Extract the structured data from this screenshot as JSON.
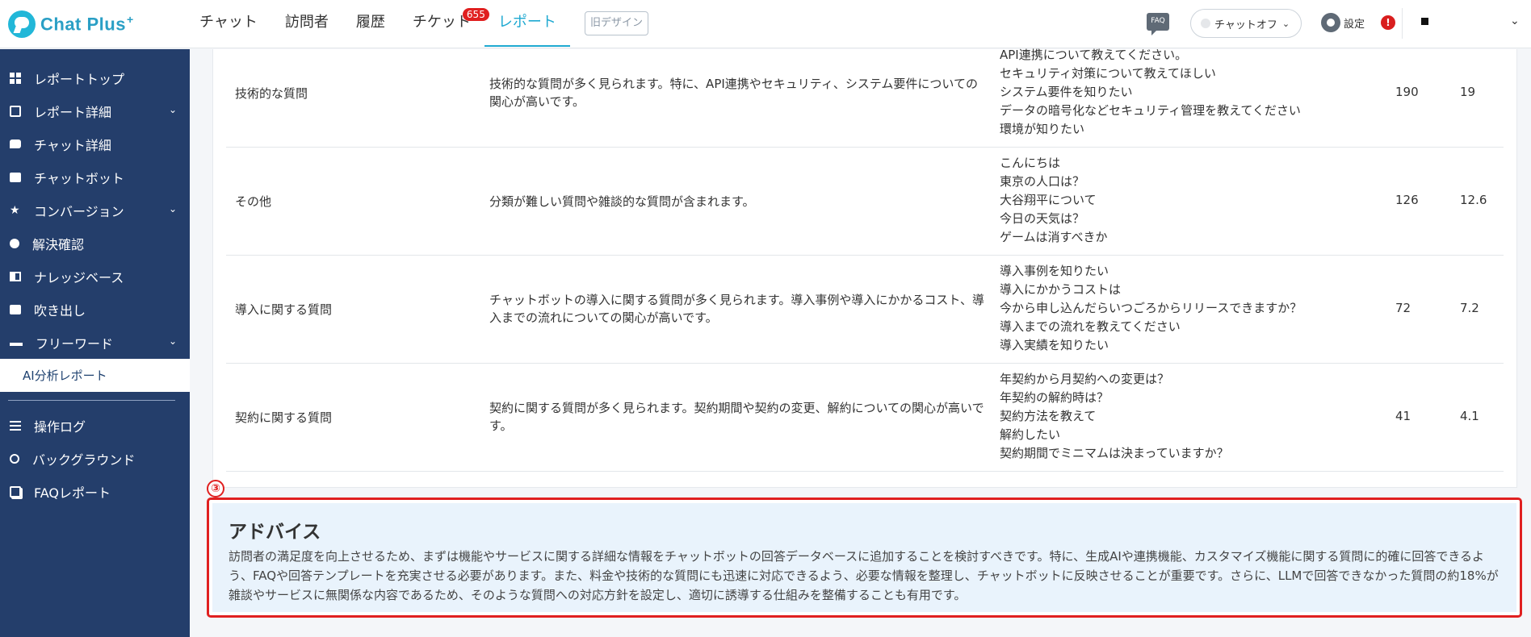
{
  "header": {
    "logo_text": "Chat Plus",
    "logo_sup": "+",
    "nav": [
      {
        "label": "チャット"
      },
      {
        "label": "訪問者"
      },
      {
        "label": "履歴"
      },
      {
        "label": "チケット",
        "badge": "655"
      },
      {
        "label": "レポート",
        "active": true
      }
    ],
    "old_design": "旧デザイン",
    "faq_label": "FAQ",
    "chat_toggle": "チャットオフ",
    "settings": "設定",
    "alert": "!"
  },
  "sidebar": {
    "items": [
      {
        "label": "レポートトップ",
        "icon": "grid-icon"
      },
      {
        "label": "レポート詳細",
        "icon": "report-icon",
        "expand": true
      },
      {
        "label": "チャット詳細",
        "icon": "chat-icon"
      },
      {
        "label": "チャットボット",
        "icon": "bot-icon"
      },
      {
        "label": "コンバージョン",
        "icon": "star-icon",
        "expand": true
      },
      {
        "label": "解決確認",
        "icon": "bulb-icon"
      },
      {
        "label": "ナレッジベース",
        "icon": "book-icon"
      },
      {
        "label": "吹き出し",
        "icon": "speech-icon"
      },
      {
        "label": "フリーワード",
        "icon": "keyboard-icon",
        "expand": true
      },
      {
        "label": "AI分析レポート",
        "active": true
      }
    ],
    "bottom_items": [
      {
        "label": "操作ログ",
        "icon": "list-icon"
      },
      {
        "label": "バックグラウンド",
        "icon": "gears-icon"
      },
      {
        "label": "FAQレポート",
        "icon": "copy-icon"
      }
    ]
  },
  "table": {
    "rows": [
      {
        "category": "技術的な質問",
        "description": "技術的な質問が多く見られます。特に、API連携やセキュリティ、システム要件についての関心が高いです。",
        "examples": [
          "API連携について教えてください。",
          "セキュリティ対策について教えてほしい",
          "システム要件を知りたい",
          "データの暗号化などセキュリティ管理を教えてください",
          "環境が知りたい"
        ],
        "count": "190",
        "percent": "19"
      },
      {
        "category": "その他",
        "description": "分類が難しい質問や雑談的な質問が含まれます。",
        "examples": [
          "こんにちは",
          "東京の人口は？",
          "大谷翔平について",
          "今日の天気は？",
          "ゲームは消すべきか"
        ],
        "count": "126",
        "percent": "12.6"
      },
      {
        "category": "導入に関する質問",
        "description": "チャットボットの導入に関する質問が多く見られます。導入事例や導入にかかるコスト、導入までの流れについての関心が高いです。",
        "examples": [
          "導入事例を知りたい",
          "導入にかかうコストは",
          "今から申し込んだらいつごろからリリースできますか？",
          "導入までの流れを教えてください",
          "導入実績を知りたい"
        ],
        "count": "72",
        "percent": "7.2"
      },
      {
        "category": "契約に関する質問",
        "description": "契約に関する質問が多く見られます。契約期間や契約の変更、解約についての関心が高いです。",
        "examples": [
          "年契約から月契約への変更は？",
          "年契約の解約時は？",
          "契約方法を教えて",
          "解約したい",
          "契約期間でミニマムは決まっていますか？"
        ],
        "count": "41",
        "percent": "4.1"
      }
    ]
  },
  "advice": {
    "marker": "③",
    "title": "アドバイス",
    "body": "訪問者の満足度を向上させるため、まずは機能やサービスに関する詳細な情報をチャットボットの回答データベースに追加することを検討すべきです。特に、生成AIや連携機能、カスタマイズ機能に関する質問に的確に回答できるよう、FAQや回答テンプレートを充実させる必要があります。また、料金や技術的な質問にも迅速に対応できるよう、必要な情報を整理し、チャットボットに反映させることが重要です。さらに、LLMで回答できなかった質問の約18%が雑談やサービスに無関係な内容であるため、そのような質問への対応方針を設定し、適切に誘導する仕組みを整備することも有用です。"
  }
}
